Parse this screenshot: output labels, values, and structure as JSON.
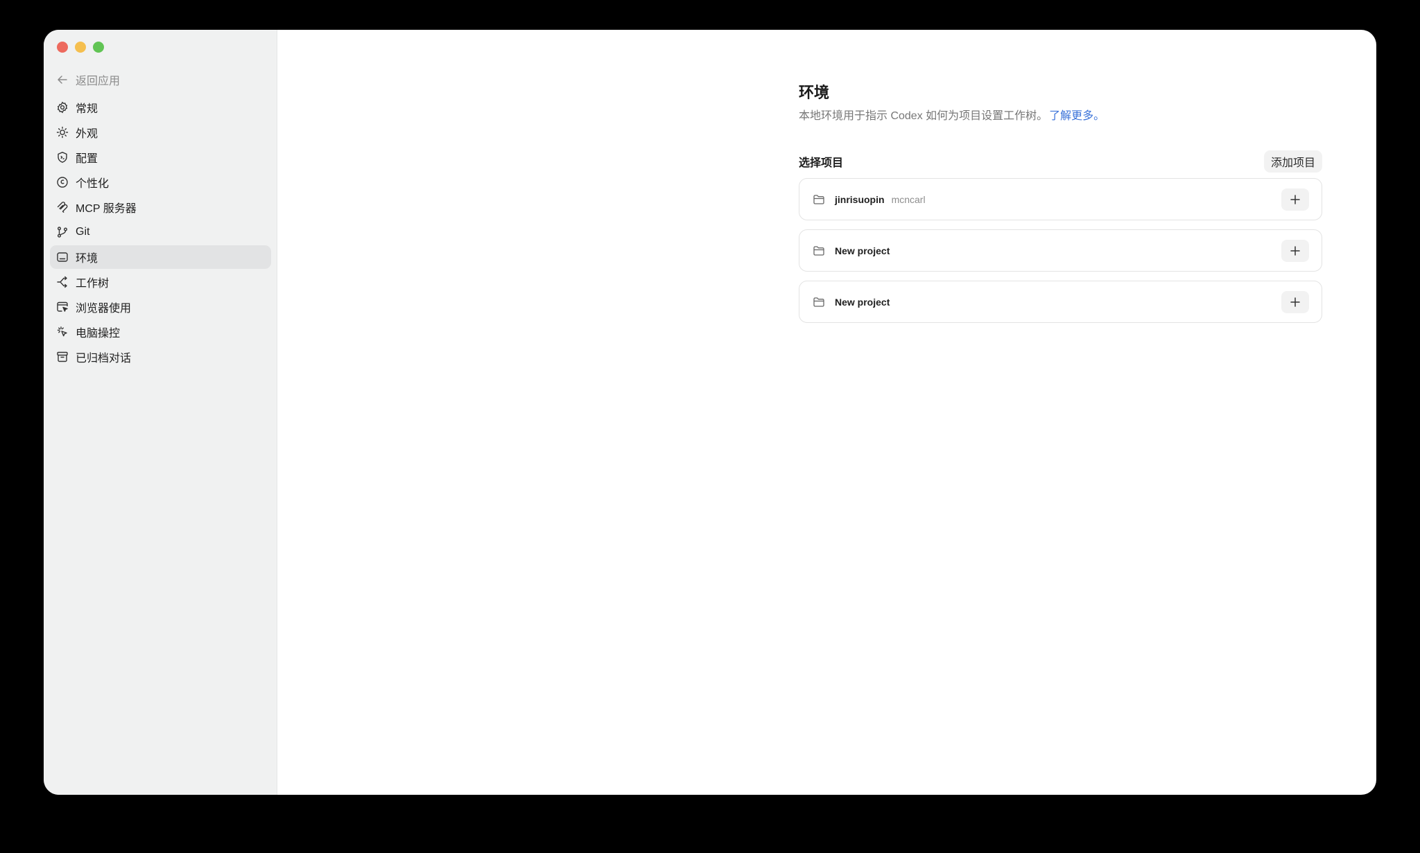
{
  "sidebar": {
    "back_label": "返回应用",
    "items": [
      {
        "label": "常规",
        "icon": "gear-icon"
      },
      {
        "label": "外观",
        "icon": "sun-icon"
      },
      {
        "label": "配置",
        "icon": "shield-config-icon"
      },
      {
        "label": "个性化",
        "icon": "personalize-icon"
      },
      {
        "label": "MCP 服务器",
        "icon": "mcp-icon"
      },
      {
        "label": "Git",
        "icon": "git-branch-icon"
      },
      {
        "label": "环境",
        "icon": "terminal-icon",
        "active": true
      },
      {
        "label": "工作树",
        "icon": "worktree-icon"
      },
      {
        "label": "浏览器使用",
        "icon": "browser-cursor-icon"
      },
      {
        "label": "电脑操控",
        "icon": "click-icon"
      },
      {
        "label": "已归档对话",
        "icon": "archive-icon"
      }
    ]
  },
  "main": {
    "title": "环境",
    "description": "本地环境用于指示 Codex 如何为项目设置工作树。",
    "learn_more": "了解更多。",
    "section_title": "选择项目",
    "add_button": "添加项目",
    "projects": [
      {
        "name": "jinrisuopin",
        "owner": "mcncarl"
      },
      {
        "name": "New project",
        "owner": ""
      },
      {
        "name": "New project",
        "owner": ""
      }
    ]
  },
  "colors": {
    "accent_link": "#3b73d9",
    "sidebar_bg": "#f0f1f1",
    "active_item_bg": "#e2e3e4"
  }
}
